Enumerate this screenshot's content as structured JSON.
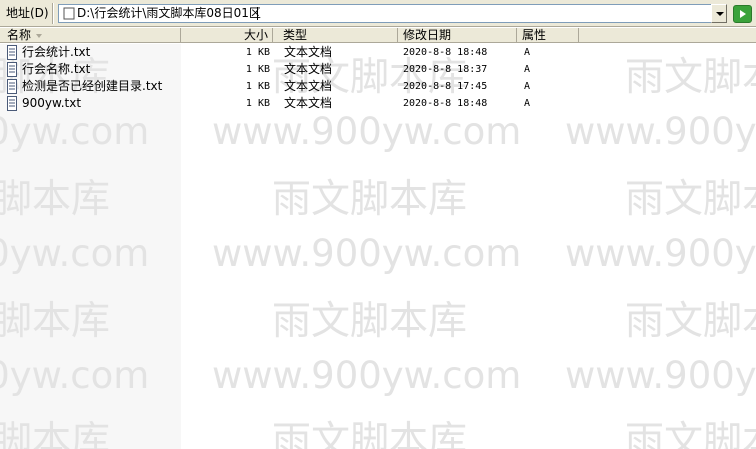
{
  "address_bar": {
    "label": "地址(D)",
    "path": "D:\\行会统计\\雨文脚本库08日01区"
  },
  "columns": [
    "名称",
    "大小",
    "类型",
    "修改日期",
    "属性"
  ],
  "files": [
    {
      "name": "行会统计.txt",
      "size": "1 KB",
      "type": "文本文档",
      "modified": "2020-8-8 18:48",
      "attr": "A"
    },
    {
      "name": "行会名称.txt",
      "size": "1 KB",
      "type": "文本文档",
      "modified": "2020-8-8 18:37",
      "attr": "A"
    },
    {
      "name": "检测是否已经创建目录.txt",
      "size": "1 KB",
      "type": "文本文档",
      "modified": "2020-8-8 17:45",
      "attr": "A"
    },
    {
      "name": "900yw.txt",
      "size": "1 KB",
      "type": "文本文档",
      "modified": "2020-8-8 18:48",
      "attr": "A"
    }
  ],
  "watermark": {
    "url": "www.900yw.com",
    "cn": "雨文脚本库"
  }
}
